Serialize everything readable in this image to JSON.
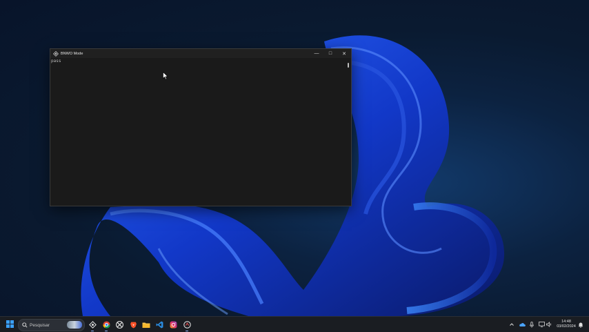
{
  "window": {
    "title": "BNWO Mode",
    "controls": {
      "minimize": "—",
      "maximize": "□",
      "close": "✕"
    },
    "console_text": "pass"
  },
  "taskbar": {
    "search_placeholder": "Pesquisar",
    "pinned_icons": [
      "app-icon",
      "chrome-icon",
      "xbox-icon",
      "brave-icon",
      "file-explorer-icon",
      "vscode-icon",
      "instagram-icon",
      "app-icon-2"
    ],
    "tray_icons": [
      "chevron-up-icon",
      "onedrive-icon",
      "microphone-icon",
      "display-icon",
      "volume-icon",
      "notification-icon"
    ],
    "time": "14:48",
    "date": "03/02/2024"
  },
  "colors": {
    "wallpaper_dark": "#0a1a30",
    "bloom_blue": "#1f4fd8",
    "window_bg": "#1c1c1c",
    "taskbar_bg": "#1a1d22",
    "accent": "#3aa0ff"
  }
}
